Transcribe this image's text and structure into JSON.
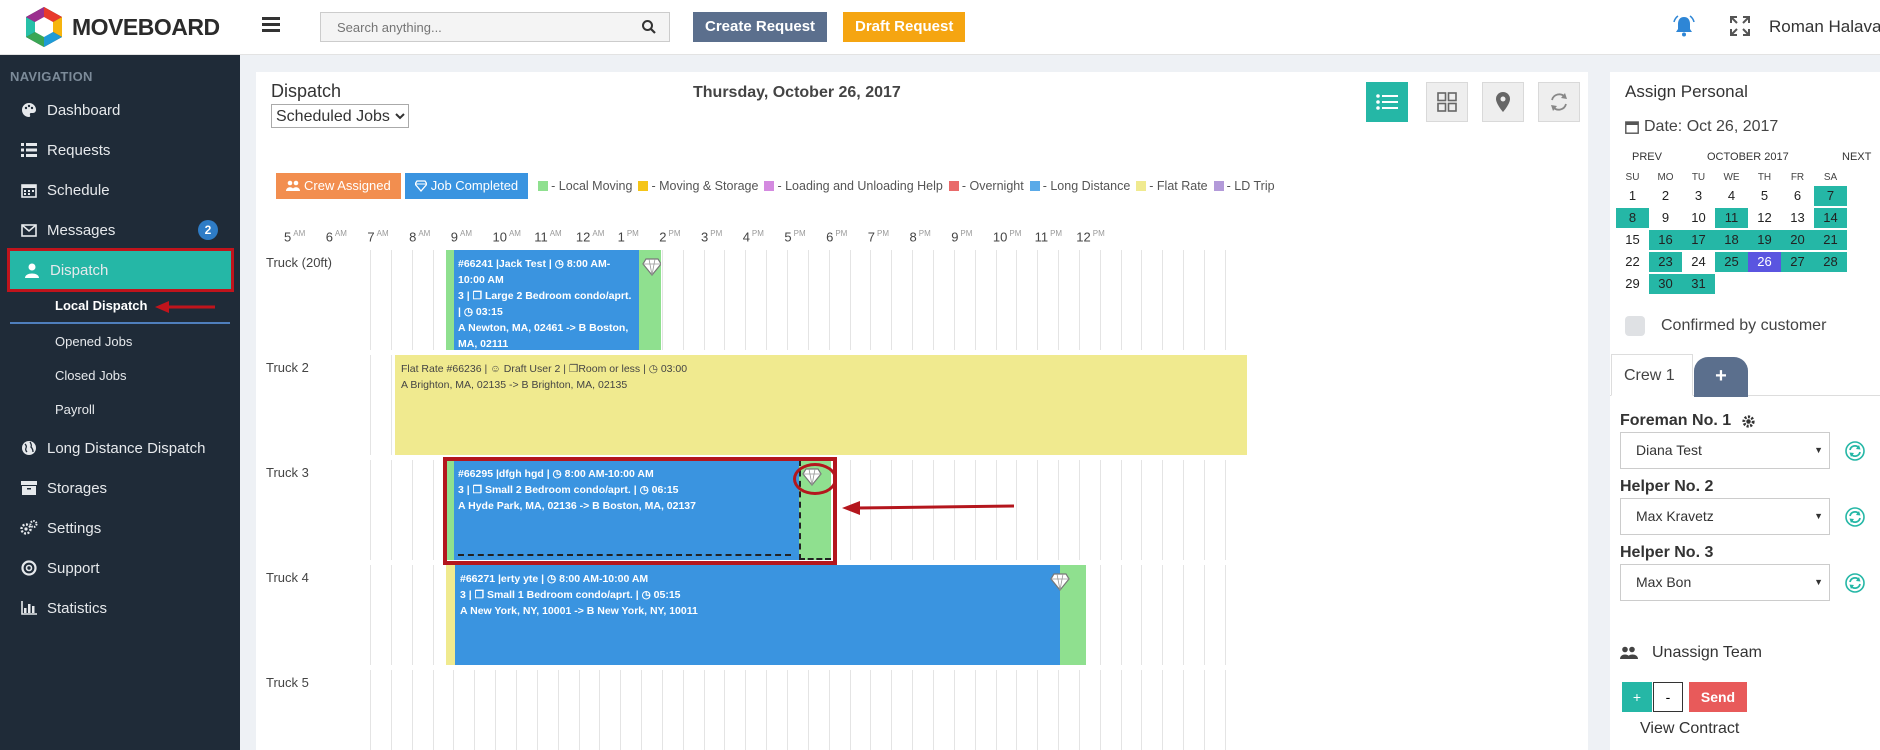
{
  "app": {
    "logo_text": "MOVEBOARD",
    "search_placeholder": "Search anything...",
    "create_request": "Create Request",
    "draft_request": "Draft Request",
    "username": "Roman Halavach"
  },
  "sidebar": {
    "title": "NAVIGATION",
    "items": [
      {
        "label": "Dashboard",
        "icon": "palette-icon"
      },
      {
        "label": "Requests",
        "icon": "list-icon"
      },
      {
        "label": "Schedule",
        "icon": "calendar-icon"
      },
      {
        "label": "Messages",
        "icon": "envelope-icon",
        "badge": "2"
      },
      {
        "label": "Dispatch",
        "icon": "user-icon",
        "active": true
      },
      {
        "label": "Long Distance Dispatch",
        "icon": "globe-icon"
      },
      {
        "label": "Storages",
        "icon": "archive-icon"
      },
      {
        "label": "Settings",
        "icon": "cogs-icon"
      },
      {
        "label": "Support",
        "icon": "lifebuoy-icon"
      },
      {
        "label": "Statistics",
        "icon": "bar-chart-icon"
      }
    ],
    "subitems": [
      "Local Dispatch",
      "Opened Jobs",
      "Closed Jobs",
      "Payroll"
    ]
  },
  "dispatch": {
    "title": "Dispatch",
    "filter_selected": "Scheduled Jobs",
    "date": "Thursday, October 26, 2017"
  },
  "legend": {
    "crew_assigned": "Crew Assigned",
    "job_completed": "Job Completed",
    "items": [
      {
        "label": "- Local Moving",
        "color": "#8fe08f"
      },
      {
        "label": "- Moving & Storage",
        "color": "#f5c518"
      },
      {
        "label": "- Loading and Unloading Help",
        "color": "#d48ae0"
      },
      {
        "label": "- Overnight",
        "color": "#e96a6a"
      },
      {
        "label": "- Long Distance",
        "color": "#5aaae8"
      },
      {
        "label": "- Flat Rate",
        "color": "#f0ea8f"
      },
      {
        "label": "- LD Trip",
        "color": "#b39ad9"
      }
    ]
  },
  "timeline": {
    "hours": [
      {
        "n": "5",
        "p": "AM"
      },
      {
        "n": "6",
        "p": "AM"
      },
      {
        "n": "7",
        "p": "AM"
      },
      {
        "n": "8",
        "p": "AM"
      },
      {
        "n": "9",
        "p": "AM"
      },
      {
        "n": "10",
        "p": "AM"
      },
      {
        "n": "11",
        "p": "AM"
      },
      {
        "n": "12",
        "p": "AM"
      },
      {
        "n": "1",
        "p": "PM"
      },
      {
        "n": "2",
        "p": "PM"
      },
      {
        "n": "3",
        "p": "PM"
      },
      {
        "n": "4",
        "p": "PM"
      },
      {
        "n": "5",
        "p": "PM"
      },
      {
        "n": "6",
        "p": "PM"
      },
      {
        "n": "7",
        "p": "PM"
      },
      {
        "n": "8",
        "p": "PM"
      },
      {
        "n": "9",
        "p": "PM"
      },
      {
        "n": "10",
        "p": "PM"
      },
      {
        "n": "11",
        "p": "PM"
      },
      {
        "n": "12",
        "p": "PM"
      }
    ],
    "trucks": [
      "Truck (20ft)",
      "Truck 2",
      "Truck 3",
      "Truck 4",
      "Truck 5"
    ]
  },
  "jobs": [
    {
      "line1": "#66241 |Jack Test | ◷ 8:00 AM-10:00 AM",
      "line2": "3 | ❐ Large 2 Bedroom condo/aprt. | ◷ 03:15",
      "line3": "A Newton, MA, 02461 -> B Boston, MA, 02111"
    },
    {
      "line1": "Flat Rate #66236 | ☺ Draft User 2 | ❐Room or less | ◷ 03:00",
      "line2": "A Brighton, MA, 02135 -> B Brighton, MA, 02135"
    },
    {
      "line1": "#66295 |dfgh hgd | ◷ 8:00 AM-10:00 AM",
      "line2": "3 | ❐ Small 2 Bedroom condo/aprt. | ◷ 06:15",
      "line3": "A Hyde Park, MA, 02136 -> B Boston, MA, 02137"
    },
    {
      "line1": "#66271 |erty yte | ◷ 8:00 AM-10:00 AM",
      "line2": "3 | ❐ Small 1 Bedroom condo/aprt. | ◷ 05:15",
      "line3": "A New York, NY, 10001 -> B New York, NY, 10011"
    }
  ],
  "assign": {
    "title": "Assign Personal",
    "date": "Date: Oct 26, 2017",
    "cal_prev": "PREV",
    "cal_month": "OCTOBER 2017",
    "cal_next": "NEXT",
    "dow": [
      "SU",
      "MO",
      "TU",
      "WE",
      "TH",
      "FR",
      "SA"
    ],
    "weeks": [
      [
        "1",
        "2",
        "3",
        "4",
        "5",
        "6",
        "7"
      ],
      [
        "8",
        "9",
        "10",
        "11",
        "12",
        "13",
        "14"
      ],
      [
        "15",
        "16",
        "17",
        "18",
        "19",
        "20",
        "21"
      ],
      [
        "22",
        "23",
        "24",
        "25",
        "26",
        "27",
        "28"
      ],
      [
        "29",
        "30",
        "31",
        "",
        "",
        "",
        ""
      ]
    ],
    "confirmed": "Confirmed by customer",
    "crew_tab": "Crew 1",
    "add_tab": "+",
    "foreman_label": "Foreman No. 1",
    "foreman_value": "Diana Test",
    "helper2_label": "Helper No. 2",
    "helper2_value": "Max Kravetz",
    "helper3_label": "Helper No. 3",
    "helper3_value": "Max Bon",
    "unassign": "Unassign Team",
    "plus": "+",
    "minus": "-",
    "send": "Send",
    "view_contract": "View Contract"
  }
}
